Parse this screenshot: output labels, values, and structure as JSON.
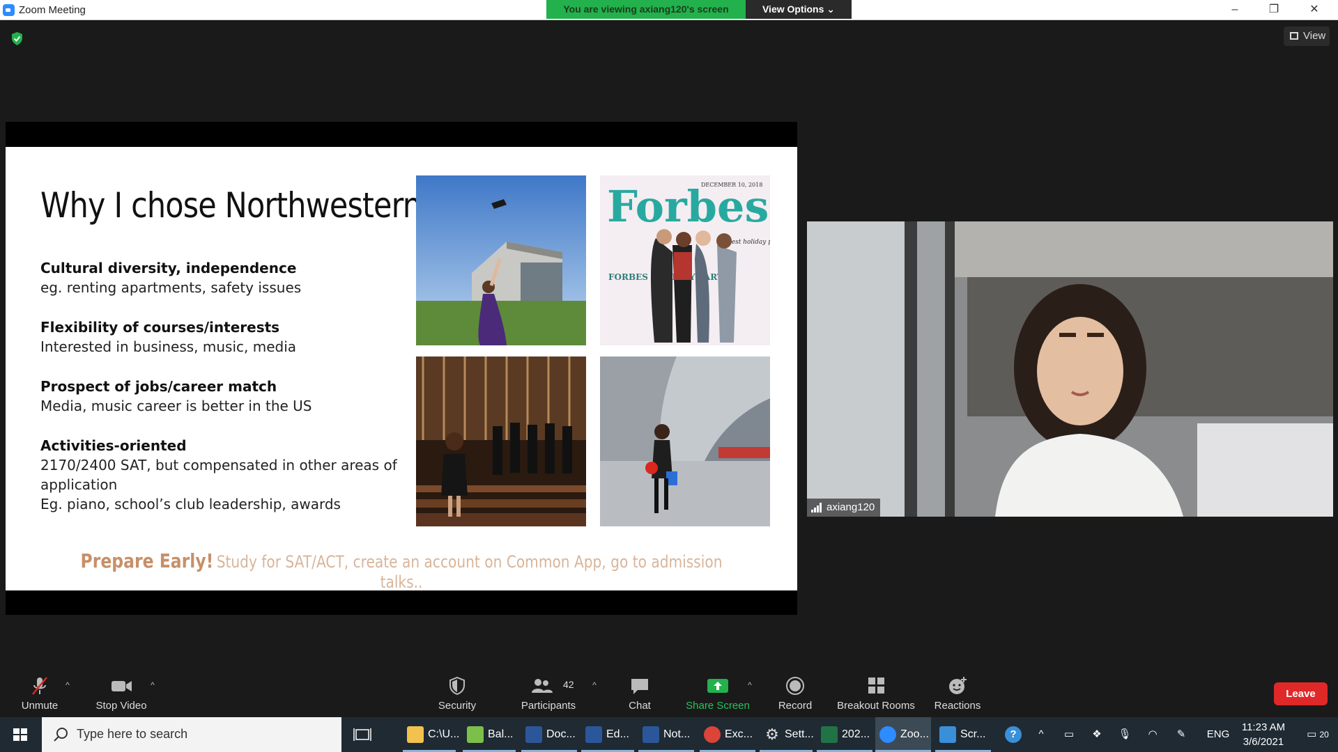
{
  "titlebar": {
    "title": "Zoom Meeting",
    "viewing_banner": "You are viewing axiang120's screen",
    "view_options": "View Options"
  },
  "view_button": {
    "label": "View"
  },
  "slide": {
    "title": "Why I chose Northwestern",
    "bullets": [
      {
        "heading": "Cultural diversity, independence",
        "detail": "eg. renting apartments, safety issues"
      },
      {
        "heading": "Flexibility of courses/interests",
        "detail": "Interested in business, music, media"
      },
      {
        "heading": "Prospect of jobs/career match",
        "detail": "Media, music career is better in the US"
      },
      {
        "heading": "Activities-oriented",
        "detail": "2170/2400 SAT,  but compensated in other areas of application\nEg. piano, school’s club leadership, awards"
      }
    ],
    "magazine": {
      "masthead": "Forbes",
      "date": "DECEMBER 10, 2018",
      "tagline": "\"Best holiday party ever!\"",
      "cover_text": "FORBES HOLIDAY PARTY"
    },
    "footer_strong": "Prepare Early!",
    "footer_rest": "Study for SAT/ACT, create an account on Common App, go to admission talks.."
  },
  "participant": {
    "name": "axiang120"
  },
  "toolbar": {
    "unmute": "Unmute",
    "stop_video": "Stop Video",
    "security": "Security",
    "participants": "Participants",
    "participant_count": "42",
    "chat": "Chat",
    "share_screen": "Share Screen",
    "record": "Record",
    "breakout_rooms": "Breakout Rooms",
    "reactions": "Reactions",
    "leave": "Leave"
  },
  "taskbar": {
    "search_placeholder": "Type here to search",
    "apps": [
      {
        "label": "C:\\U...",
        "icon": "folder-icon",
        "color": "#f2c14e"
      },
      {
        "label": "Bal...",
        "icon": "balsamiq-icon",
        "color": "#7cc04a"
      },
      {
        "label": "Doc...",
        "icon": "word-icon",
        "color": "#2b579a"
      },
      {
        "label": "Ed...",
        "icon": "word-icon",
        "color": "#2b579a"
      },
      {
        "label": "Not...",
        "icon": "word-icon",
        "color": "#2b579a"
      },
      {
        "label": "Exc...",
        "icon": "chrome-icon",
        "color": "#db4437"
      },
      {
        "label": "Sett...",
        "icon": "gear-icon",
        "color": "#dddddd"
      },
      {
        "label": "202...",
        "icon": "excel-icon",
        "color": "#217346"
      },
      {
        "label": "Zoo...",
        "icon": "zoom-icon",
        "color": "#2d8cff"
      },
      {
        "label": "Scr...",
        "icon": "photos-icon",
        "color": "#3a8fd9"
      }
    ],
    "language": "ENG",
    "time": "11:23 AM",
    "date": "3/6/2021",
    "notification_count": "20"
  }
}
